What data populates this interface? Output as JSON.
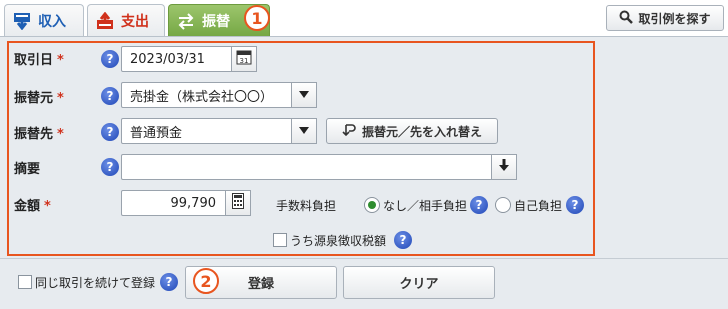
{
  "tabs": {
    "income": "収入",
    "expense": "支出",
    "transfer": "振替"
  },
  "markers": {
    "one": "1",
    "two": "2"
  },
  "search_button": "取引例を探す",
  "form": {
    "date": {
      "label": "取引日",
      "required": "*",
      "value": "2023/03/31"
    },
    "from": {
      "label": "振替元",
      "required": "*",
      "value": "売掛金（株式会社〇〇）"
    },
    "to": {
      "label": "振替先",
      "required": "*",
      "value": "普通預金"
    },
    "swap_button": "振替元／先を入れ替え",
    "memo": {
      "label": "摘要",
      "value": ""
    },
    "amount": {
      "label": "金額",
      "required": "*",
      "value": "99,790"
    },
    "fee": {
      "label": "手数料負担",
      "option_none": "なし／相手負担",
      "option_self": "自己負担",
      "selected": "なし／相手負担"
    },
    "withholding": "うち源泉徴収税額"
  },
  "footer": {
    "repeat_checkbox": "同じ取引を続けて登録",
    "register_button": "登録",
    "clear_button": "クリア"
  },
  "help_glyph": "?",
  "colors": {
    "accent": "#e8551f",
    "income": "#1e5fb4",
    "expense": "#d0311c",
    "transfer": "#76a845",
    "help": "#1f46b6"
  }
}
